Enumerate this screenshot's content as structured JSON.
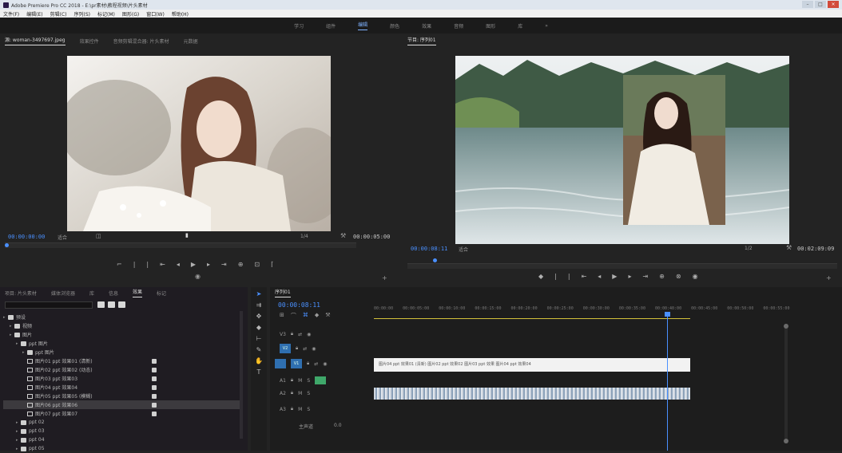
{
  "window": {
    "title": "Adobe Premiere Pro CC 2018 - E:\\pr素材\\教程视频\\片头素材"
  },
  "menubar": {
    "items": [
      "文件(F)",
      "编辑(E)",
      "剪辑(C)",
      "序列(S)",
      "标记(M)",
      "图形(G)",
      "窗口(W)",
      "帮助(H)"
    ]
  },
  "workspaces": {
    "items": [
      "学习",
      "组件",
      "编辑",
      "颜色",
      "效果",
      "音频",
      "图形",
      "库"
    ],
    "active_index": 2,
    "more": "»"
  },
  "source": {
    "tabs": [
      "源: woman-3497697.jpeg",
      "效果控件",
      "音频剪辑混合器: 片头素材",
      "元数据"
    ],
    "active_tab": 0,
    "timecode_in": "00:00:00:00",
    "zoom": "适合",
    "fraction": "1/4",
    "duration": "00:00:05:00"
  },
  "program": {
    "tabs": [
      "节目: 序列01"
    ],
    "timecode": "00:00:08:11",
    "zoom": "适合",
    "fraction": "1/2",
    "duration": "00:02:09:09"
  },
  "project": {
    "tabs": [
      "项目: 片头素材",
      "媒体浏览器",
      "库",
      "信息",
      "效果",
      "标记"
    ],
    "active_tab": 4,
    "tree": [
      {
        "depth": 0,
        "icon": "folder",
        "label": "预设"
      },
      {
        "depth": 1,
        "icon": "folder",
        "label": "视频"
      },
      {
        "depth": 1,
        "icon": "folder",
        "label": "图片"
      },
      {
        "depth": 2,
        "icon": "folder",
        "label": "ppt 图片"
      },
      {
        "depth": 3,
        "icon": "folder",
        "label": "ppt 图片"
      },
      {
        "depth": 3,
        "icon": "seq",
        "label": "图片01 ppt 效果01 (清新)",
        "badge": true
      },
      {
        "depth": 3,
        "icon": "seq",
        "label": "图片02 ppt 效果02 (动态)",
        "badge": true
      },
      {
        "depth": 3,
        "icon": "seq",
        "label": "图片03 ppt 效果03",
        "badge": true
      },
      {
        "depth": 3,
        "icon": "seq",
        "label": "图片04 ppt 效果04",
        "badge": true
      },
      {
        "depth": 3,
        "icon": "seq",
        "label": "图片05 ppt 效果05 (模糊)",
        "badge": true
      },
      {
        "depth": 3,
        "icon": "seq",
        "label": "图片06 ppt 效果06",
        "badge": true,
        "selected": true
      },
      {
        "depth": 3,
        "icon": "seq",
        "label": "图片07 ppt 效果07",
        "badge": true
      },
      {
        "depth": 2,
        "icon": "folder",
        "label": "ppt 02"
      },
      {
        "depth": 2,
        "icon": "folder",
        "label": "ppt 03"
      },
      {
        "depth": 2,
        "icon": "folder",
        "label": "ppt 04"
      },
      {
        "depth": 2,
        "icon": "folder",
        "label": "ppt 05"
      }
    ]
  },
  "timeline": {
    "tabs": [
      "序列01"
    ],
    "timecode": "00:00:08:11",
    "ruler": [
      "00:00:00",
      "00:00:05:00",
      "00:00:10:00",
      "00:00:15:00",
      "00:00:20:00",
      "00:00:25:00",
      "00:00:30:00",
      "00:00:35:00",
      "00:00:40:00",
      "00:00:45:00",
      "00:00:50:00",
      "00:00:55:00"
    ],
    "tracks": [
      {
        "name": "V3",
        "clip": ""
      },
      {
        "name": "V2",
        "clip": ""
      },
      {
        "name": "V1",
        "clip": "图片04 ppt 效果01 (清新) 图片02 ppt 效果02 图片03 ppt 效果 图片04 ppt 效果04"
      },
      {
        "name": "A1",
        "clip": ""
      },
      {
        "name": "A2",
        "clip": ""
      },
      {
        "name": "A3",
        "clip": ""
      }
    ],
    "master_label": "主声道",
    "master_value": "0.0"
  },
  "colors": {
    "accent": "#4a90ff",
    "selection": "#3c3a3e",
    "workarea": "#d4c23a"
  }
}
